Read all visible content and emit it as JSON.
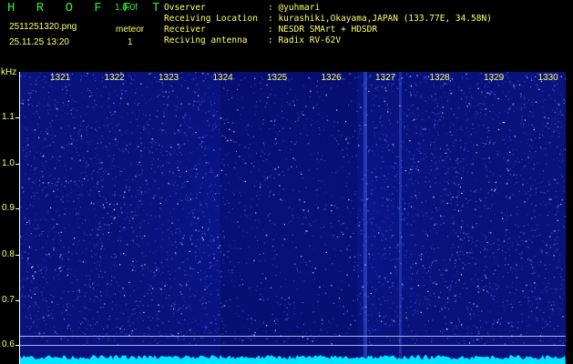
{
  "header": {
    "app_name": "H R O F F T",
    "version": "1.0.0f",
    "file_name": "2511251320.png",
    "timestamp": "25.11.25 13:20",
    "meteor_label": "meteor",
    "meteor_count": "1"
  },
  "info": [
    {
      "key": "Ovserver",
      "value": ": @yuhmari"
    },
    {
      "key": "Receiving Location",
      "value": ": kurashiki,Okayama,JAPAN (133.77E, 34.58N)"
    },
    {
      "key": "Receiver",
      "value": ": NESDR SMArt + HDSDR"
    },
    {
      "key": "Reciving antenna",
      "value": ": Radix RV-62V"
    }
  ],
  "chart_data": {
    "type": "heatmap",
    "ylabel": "kHz",
    "y_ticks": [
      "1.1",
      "1.0",
      "0.9",
      "0.8",
      "0.7",
      "0.6"
    ],
    "x_ticks": [
      "1321",
      "1322",
      "1323",
      "1324",
      "1325",
      "1326",
      "1327",
      "1328",
      "1329",
      "1330"
    ],
    "colors": {
      "background": "#0a147f",
      "noise": "#5a7aff",
      "signal": "#33d6ff",
      "baseline": "#00e5ff"
    }
  }
}
